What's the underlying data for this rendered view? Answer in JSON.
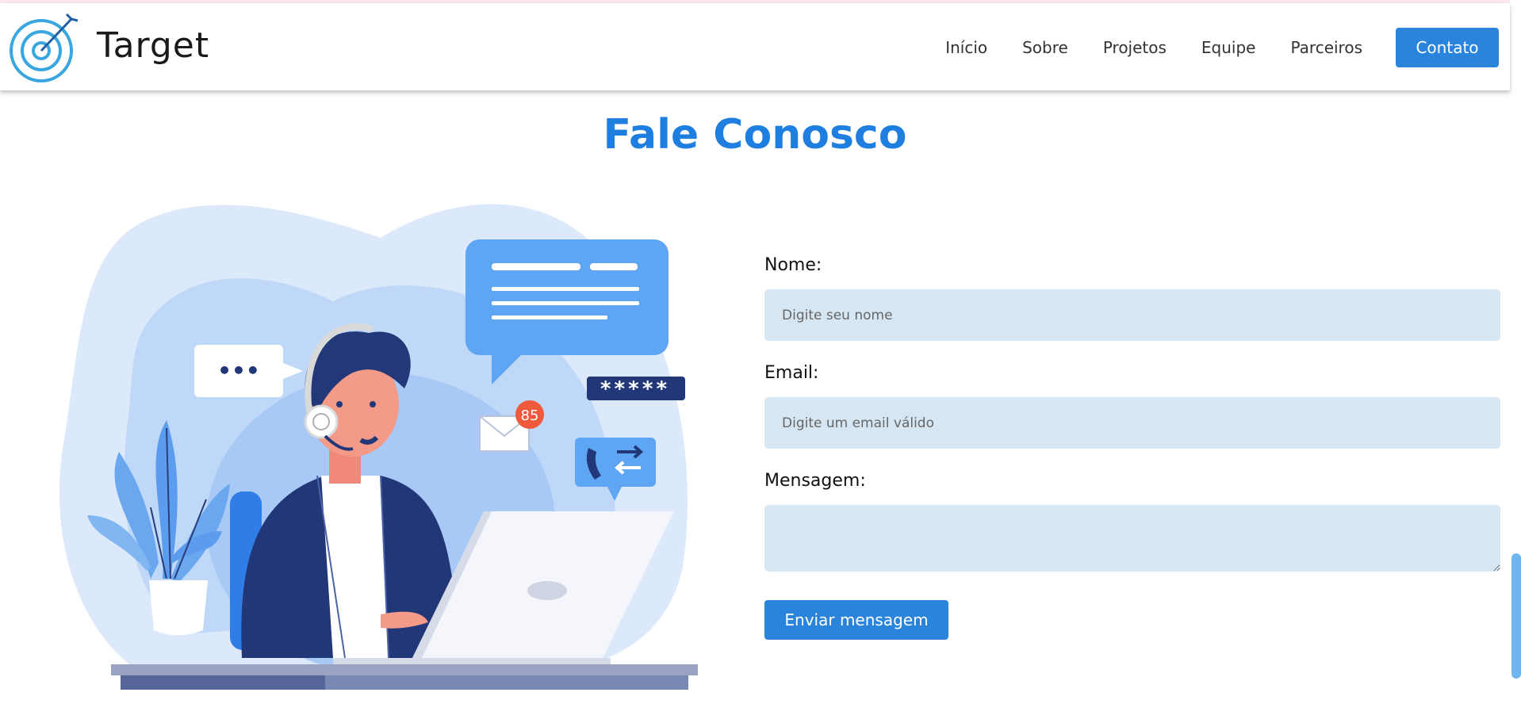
{
  "header": {
    "brand": "Target",
    "nav": [
      "Início",
      "Sobre",
      "Projetos",
      "Equipe",
      "Parceiros"
    ],
    "contact_button": "Contato"
  },
  "main": {
    "title": "Fale Conosco"
  },
  "illustration": {
    "notification_count": "85",
    "password_mask": "*****",
    "chat_dots": "•••"
  },
  "form": {
    "name_label": "Nome:",
    "name_placeholder": "Digite seu nome",
    "email_label": "Email:",
    "email_placeholder": "Digite um email válido",
    "message_label": "Mensagem:",
    "message_value": "",
    "submit_label": "Enviar mensagem"
  },
  "colors": {
    "accent": "#2a84dc",
    "title": "#1e7fe0",
    "field_bg": "#d6e6f2"
  }
}
